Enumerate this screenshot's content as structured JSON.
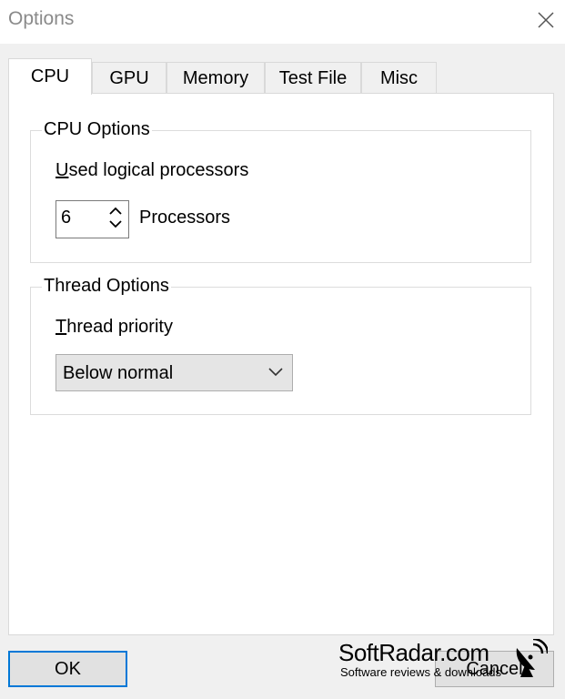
{
  "window": {
    "title": "Options"
  },
  "tabs": [
    {
      "label": "CPU"
    },
    {
      "label": "GPU"
    },
    {
      "label": "Memory"
    },
    {
      "label": "Test File"
    },
    {
      "label": "Misc"
    }
  ],
  "cpu_options": {
    "group_label": "CPU Options",
    "processors_label": "Used logical processors",
    "processors_value": "6",
    "processors_unit": "Processors"
  },
  "thread_options": {
    "group_label": "Thread Options",
    "priority_label": "Thread priority",
    "priority_value": "Below normal"
  },
  "buttons": {
    "ok": "OK",
    "cancel": "Cancel"
  },
  "watermark": {
    "title": "SoftRadar.com",
    "subtitle": "Software reviews & downloads"
  },
  "colors": {
    "accent": "#0078d7",
    "window_bg": "#f0f0f0",
    "panel_bg": "#ffffff"
  }
}
